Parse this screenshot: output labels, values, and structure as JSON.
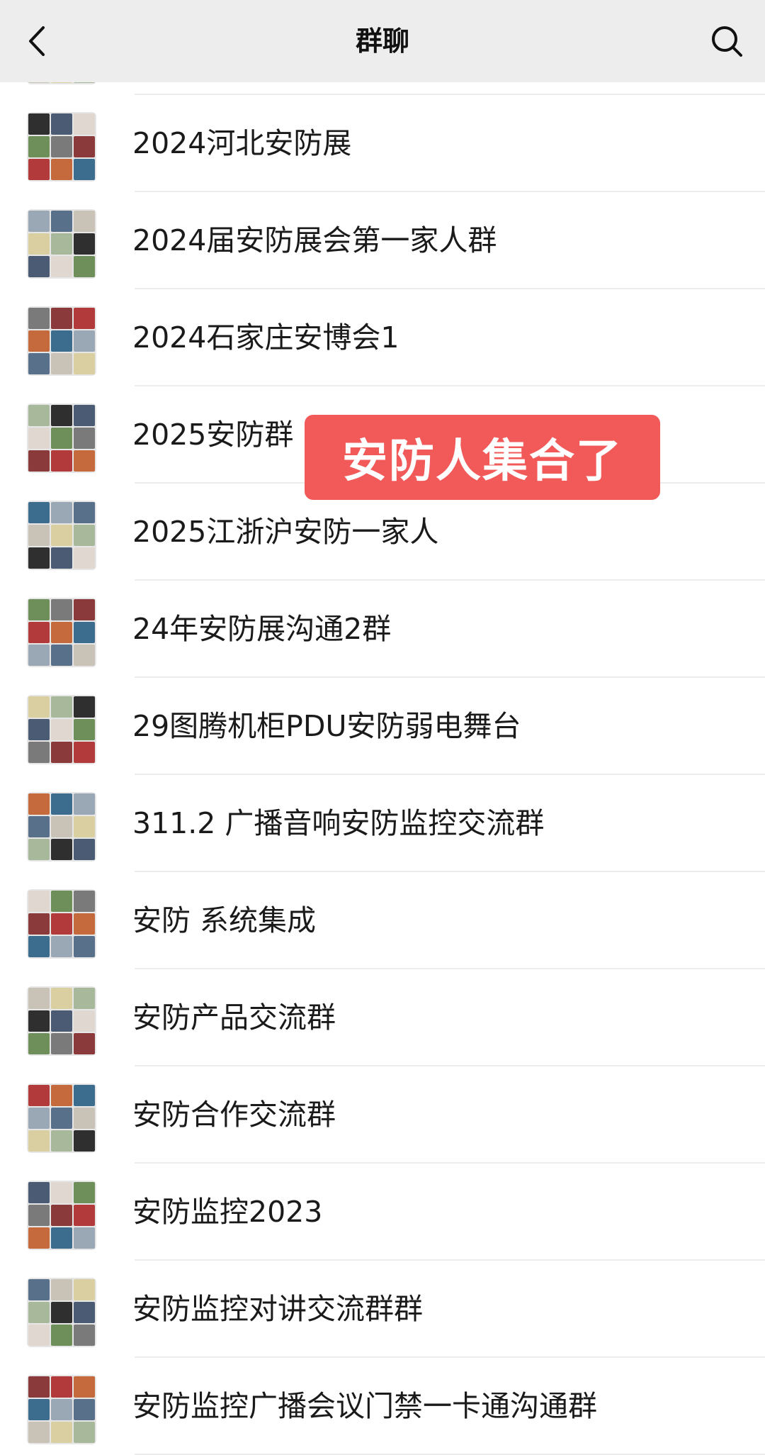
{
  "header": {
    "title": "群聊",
    "back_icon": "chevron-left-icon",
    "search_icon": "search-icon"
  },
  "overlay": {
    "text": "安防人集合了",
    "color": "#f25a5a"
  },
  "groups": [
    {
      "name": ""
    },
    {
      "name": "2024河北安防展"
    },
    {
      "name": "2024届安防展会第一家人群"
    },
    {
      "name": "2024石家庄安博会1"
    },
    {
      "name": "2025安防群"
    },
    {
      "name": "2025江浙沪安防一家人"
    },
    {
      "name": "24年安防展沟通2群"
    },
    {
      "name": "29图腾机柜PDU安防弱电舞台"
    },
    {
      "name": "311.2 广播音响安防监控交流群"
    },
    {
      "name": "安防 系统集成"
    },
    {
      "name": "安防产品交流群"
    },
    {
      "name": "安防合作交流群"
    },
    {
      "name": "安防监控2023"
    },
    {
      "name": "安防监控对讲交流群群"
    },
    {
      "name": "安防监控广播会议门禁一卡通沟通群"
    }
  ]
}
